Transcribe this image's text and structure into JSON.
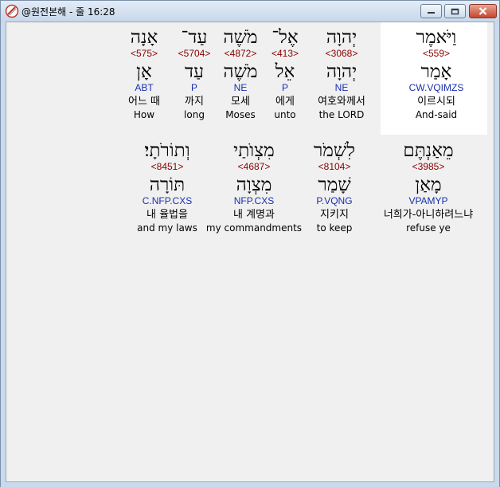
{
  "window": {
    "title": "@원전본해 - 줄 16:28",
    "icon": "app-logo-icon",
    "controls": [
      "minimize-icon",
      "maximize-icon",
      "close-icon"
    ]
  },
  "row1": [
    {
      "hebrew": "וַיֹּאמֶר",
      "strong": "<559>",
      "lemma": "אָמַר",
      "morph": "CW.VQIMZS",
      "korean": "이르시되",
      "english": "And-said"
    },
    {
      "hebrew": "יְהוָה",
      "strong": "<3068>",
      "lemma": "יְהוָה",
      "morph": "NE",
      "korean": "여호와께서",
      "english": "the LORD"
    },
    {
      "hebrew": "אֶל־",
      "strong": "<413>",
      "lemma": "אֵל",
      "morph": "P",
      "korean": "에게",
      "english": "unto"
    },
    {
      "hebrew": "מֹשֶׁה",
      "strong": "<4872>",
      "lemma": "מֹשֶׁה",
      "morph": "NE",
      "korean": "모세",
      "english": "Moses"
    },
    {
      "hebrew": "עַד־",
      "strong": "<5704>",
      "lemma": "עַד",
      "morph": "P",
      "korean": "까지",
      "english": "long"
    },
    {
      "hebrew": "אָנָה",
      "strong": "<575>",
      "lemma": "אָן",
      "morph": "ABT",
      "korean": "어느 때",
      "english": "How"
    }
  ],
  "row2": [
    {
      "hebrew": "מֵאַנְתֶּם",
      "strong": "<3985>",
      "lemma": "מָאַן",
      "morph": "VPAMYP",
      "korean": "너희가-아니하려느냐",
      "english": "refuse ye"
    },
    {
      "hebrew": "לִשְׁמֹר",
      "strong": "<8104>",
      "lemma": "שָׁמַר",
      "morph": "P.VQNG",
      "korean": "지키지",
      "english": "to keep"
    },
    {
      "hebrew": "מִצְוֺתַי",
      "strong": "<4687>",
      "lemma": "מִצְוָה",
      "morph": "NFP.CXS",
      "korean": "내 계명과",
      "english": "my commandments"
    },
    {
      "hebrew": "וְתוֹרֹתָי׃",
      "strong": "<8451>",
      "lemma": "תּוֹרָה",
      "morph": "C.NFP.CXS",
      "korean": "내 율법을",
      "english": "and my laws"
    }
  ]
}
